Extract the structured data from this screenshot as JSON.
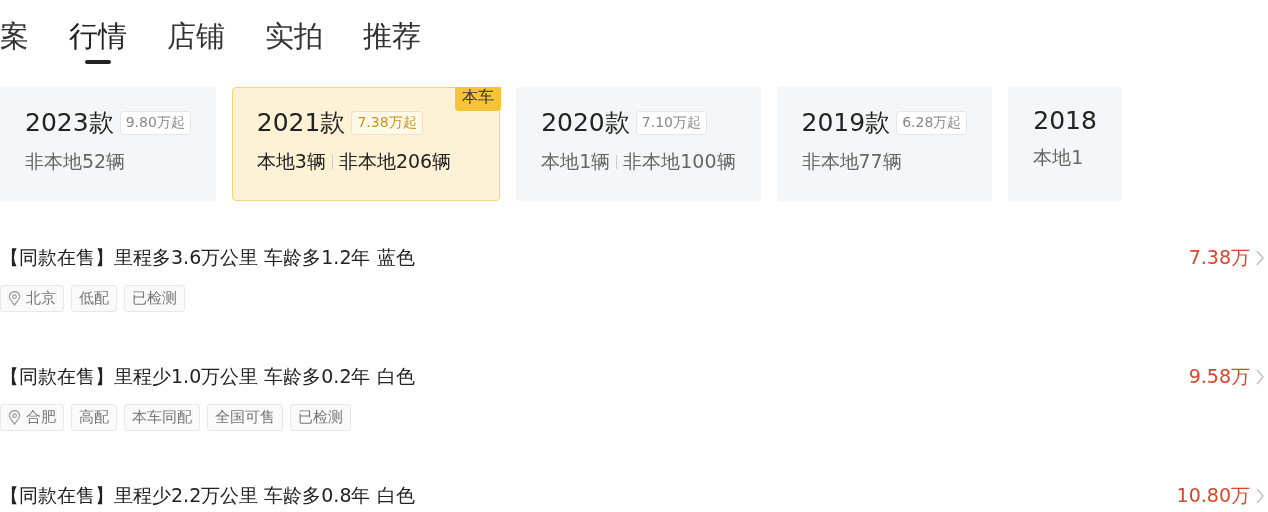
{
  "tabs": [
    {
      "label": "案",
      "selected": false
    },
    {
      "label": "行情",
      "selected": true
    },
    {
      "label": "店铺",
      "selected": false
    },
    {
      "label": "实拍",
      "selected": false
    },
    {
      "label": "推荐",
      "selected": false
    }
  ],
  "model_years": [
    {
      "year": "2023款",
      "price": "9.80万起",
      "counts": [
        "非本地52辆"
      ],
      "selected": false
    },
    {
      "year": "2021款",
      "price": "7.38万起",
      "counts": [
        "本地3辆",
        "非本地206辆"
      ],
      "selected": true,
      "badge": "本车"
    },
    {
      "year": "2020款",
      "price": "7.10万起",
      "counts": [
        "本地1辆",
        "非本地100辆"
      ],
      "selected": false
    },
    {
      "year": "2019款",
      "price": "6.28万起",
      "counts": [
        "非本地77辆"
      ],
      "selected": false
    },
    {
      "year": "2018",
      "counts": [
        "本地1"
      ],
      "selected": false
    }
  ],
  "listings": [
    {
      "title": "【同款在售】里程多3.6万公里 车龄多1.2年 蓝色",
      "price": "7.38万",
      "tags": [
        {
          "kind": "location",
          "text": "北京"
        },
        {
          "kind": "tag",
          "text": "低配"
        },
        {
          "kind": "tag",
          "text": "已检测"
        }
      ]
    },
    {
      "title": "【同款在售】里程少1.0万公里 车龄多0.2年 白色",
      "price": "9.58万",
      "tags": [
        {
          "kind": "location",
          "text": "合肥"
        },
        {
          "kind": "tag",
          "text": "高配"
        },
        {
          "kind": "tag",
          "text": "本车同配"
        },
        {
          "kind": "tag",
          "text": "全国可售"
        },
        {
          "kind": "tag",
          "text": "已检测"
        }
      ]
    },
    {
      "title": "【同款在售】里程少2.2万公里 车龄多0.8年 白色",
      "price": "10.80万"
    }
  ]
}
